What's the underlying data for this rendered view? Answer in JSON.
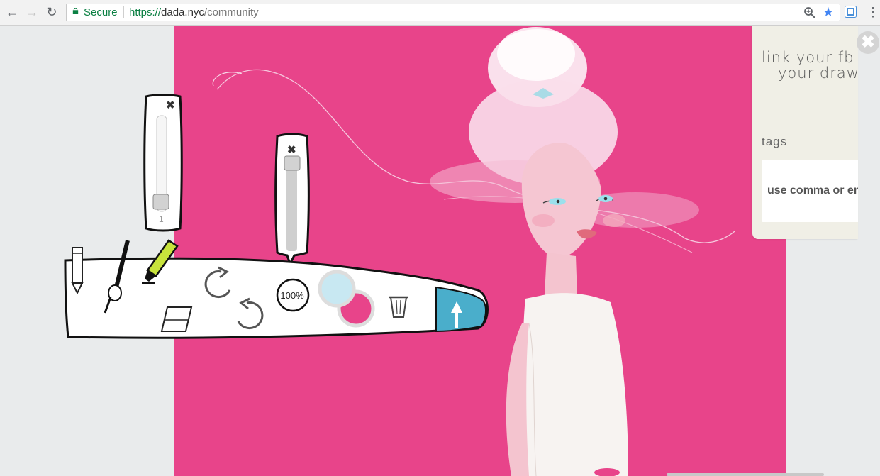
{
  "browser": {
    "secure_label": "Secure",
    "url_scheme": "https://",
    "url_host": "dada.nyc",
    "url_path": "/community",
    "back_icon": "back-arrow-icon",
    "forward_icon": "forward-arrow-icon",
    "reload_icon": "reload-icon",
    "zoom_icon": "zoom-icon",
    "bookmark_icon": "star-icon",
    "extension_icon": "extension-icon",
    "menu_icon": "menu-dots-icon"
  },
  "panel": {
    "link_line1": "link your fb a",
    "link_line2": "your drawin",
    "tags_label": "tags",
    "tags_placeholder": "use comma or ent",
    "close_icon": "close-icon"
  },
  "toolbar": {
    "tools": [
      "pencil-icon",
      "brush-icon",
      "marker-icon",
      "eraser-icon",
      "redo-icon",
      "undo-icon",
      "zoom-button",
      "color-swatch-light-blue",
      "color-swatch-pink",
      "trash-icon",
      "upload-icon"
    ],
    "zoom_label": "100%",
    "colors": {
      "primary": "#c8e8f2",
      "secondary": "#e8448a",
      "upload_bg": "#4aaecb"
    }
  },
  "size_popup": {
    "value": "1",
    "level": 0.0
  },
  "opacity_popup": {
    "level": 1.0
  },
  "colors": {
    "canvas": "#e8448a",
    "page_bg": "#e9ebec",
    "panel_bg": "#f0efe6"
  }
}
